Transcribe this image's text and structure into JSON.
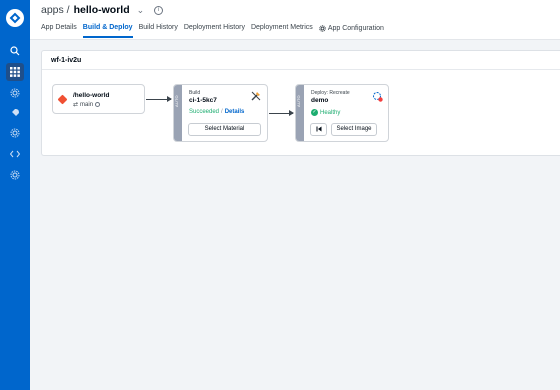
{
  "header": {
    "breadcrumb_root": "apps /",
    "app_name": "hello-world",
    "tabs": [
      {
        "label": "App Details"
      },
      {
        "label": "Build & Deploy"
      },
      {
        "label": "Build History"
      },
      {
        "label": "Deployment History"
      },
      {
        "label": "Deployment Metrics"
      },
      {
        "label": "App Configuration"
      }
    ]
  },
  "workflow": {
    "name": "wf-1-iv2u",
    "source": {
      "name": "/hello-world",
      "branch": "main"
    },
    "build": {
      "subtitle": "Build",
      "name": "ci-1-5kc7",
      "status": "Succeeded",
      "separator": "/",
      "details": "Details",
      "button": "Select Material",
      "strip_label": "AUTO"
    },
    "deploy": {
      "subtitle": "Deploy: Recreate",
      "name": "demo",
      "status": "Healthy",
      "button": "Select Image",
      "strip_label": "AUTO"
    }
  },
  "colors": {
    "sidebar": "#0066cc",
    "accent": "#0066cc",
    "success": "#1dad70",
    "git": "#f05033"
  },
  "icons": [
    "devtron-logo-icon",
    "search-icon",
    "apps-grid-icon",
    "settings-icon",
    "rocket-icon",
    "cog-icon",
    "code-icon",
    "gear-icon"
  ]
}
